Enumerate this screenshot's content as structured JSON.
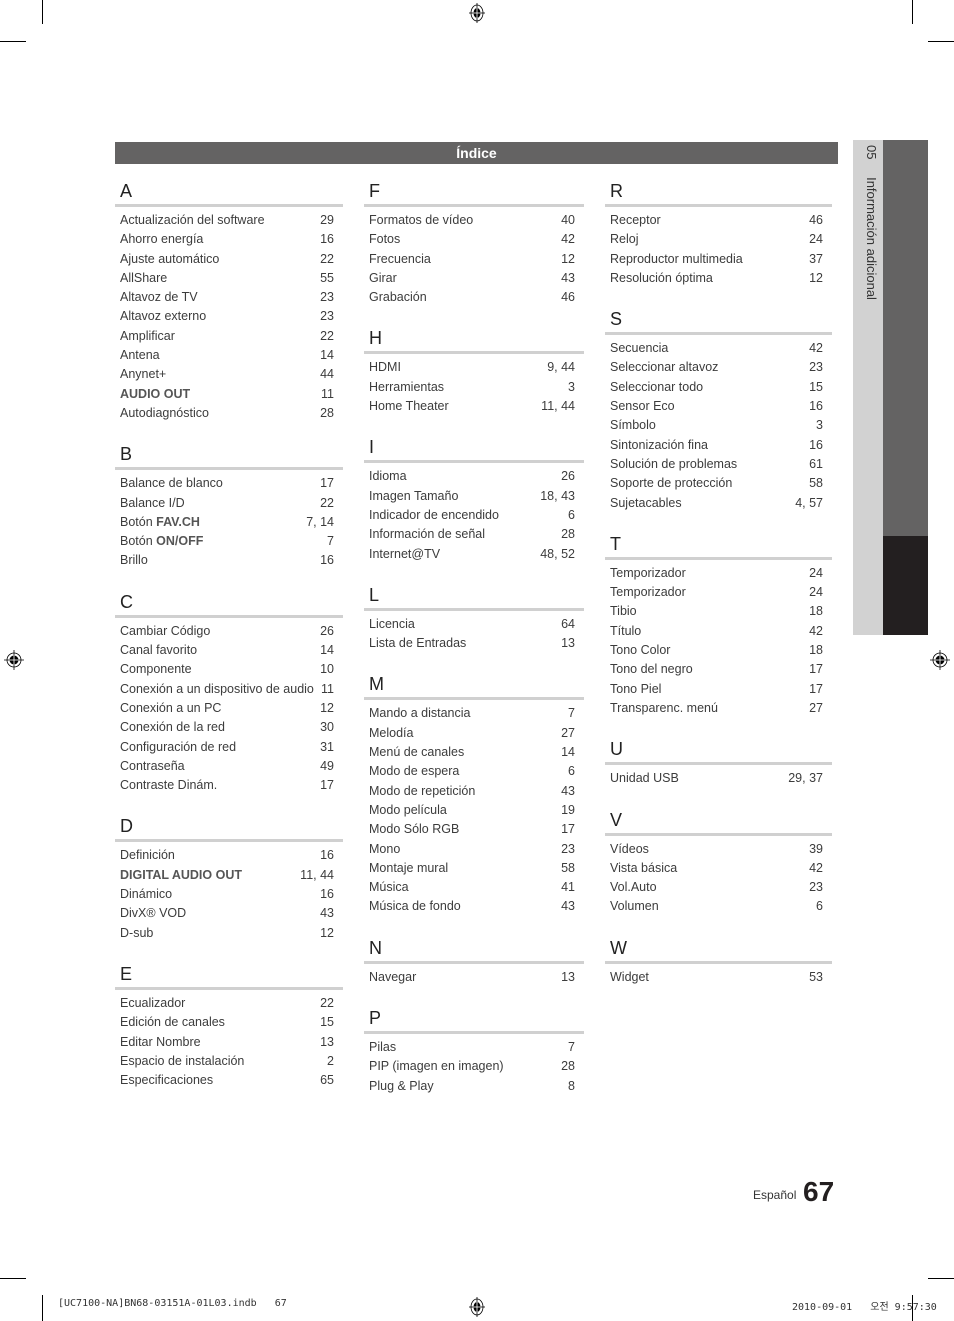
{
  "header": {
    "title": "Índice"
  },
  "side_tab": {
    "chapter_number": "05",
    "chapter_title": "Información adicional"
  },
  "columns": [
    {
      "sections": [
        {
          "letter": "A",
          "entries": [
            {
              "term": "Actualización del software",
              "pages": "29"
            },
            {
              "term": "Ahorro energía",
              "pages": "16"
            },
            {
              "term": "Ajuste automático",
              "pages": "22"
            },
            {
              "term": "AllShare",
              "pages": "55"
            },
            {
              "term": "Altavoz de TV",
              "pages": "23"
            },
            {
              "term": "Altavoz externo",
              "pages": "23"
            },
            {
              "term": "Amplificar",
              "pages": "22"
            },
            {
              "term": "Antena",
              "pages": "14"
            },
            {
              "term": "Anynet+",
              "pages": "44"
            },
            {
              "term": "AUDIO OUT",
              "pages": "11",
              "bold": true
            },
            {
              "term": "Autodiagnóstico",
              "pages": "28"
            }
          ]
        },
        {
          "letter": "B",
          "entries": [
            {
              "term": "Balance de blanco",
              "pages": "17"
            },
            {
              "term": "Balance I/D",
              "pages": "22"
            },
            {
              "term": "Botón ",
              "term_bold": "FAV.CH",
              "pages": "7, 14"
            },
            {
              "term": "Botón ",
              "term_bold": "ON/OFF",
              "pages": "7"
            },
            {
              "term": "Brillo",
              "pages": "16"
            }
          ]
        },
        {
          "letter": "C",
          "entries": [
            {
              "term": "Cambiar Código",
              "pages": "26"
            },
            {
              "term": "Canal favorito",
              "pages": "14"
            },
            {
              "term": "Componente",
              "pages": "10"
            },
            {
              "term": "Conexión a un dispositivo de audio",
              "pages": "11"
            },
            {
              "term": "Conexión a un PC",
              "pages": "12"
            },
            {
              "term": "Conexión de la red",
              "pages": "30"
            },
            {
              "term": "Configuración de red",
              "pages": "31"
            },
            {
              "term": "Contraseña",
              "pages": "49"
            },
            {
              "term": "Contraste Dinám.",
              "pages": "17"
            }
          ]
        },
        {
          "letter": "D",
          "entries": [
            {
              "term": "Definición",
              "pages": "16"
            },
            {
              "term": "DIGITAL AUDIO OUT",
              "pages": "11, 44",
              "bold": true
            },
            {
              "term": "Dinámico",
              "pages": "16"
            },
            {
              "term": "DivX® VOD",
              "pages": "43"
            },
            {
              "term": "D-sub",
              "pages": "12"
            }
          ]
        },
        {
          "letter": "E",
          "entries": [
            {
              "term": "Ecualizador",
              "pages": "22"
            },
            {
              "term": "Edición de canales",
              "pages": "15"
            },
            {
              "term": "Editar Nombre",
              "pages": "13"
            },
            {
              "term": "Espacio de instalación",
              "pages": "2"
            },
            {
              "term": "Especificaciones",
              "pages": "65"
            }
          ]
        }
      ]
    },
    {
      "sections": [
        {
          "letter": "F",
          "entries": [
            {
              "term": "Formatos de vídeo",
              "pages": "40"
            },
            {
              "term": "Fotos",
              "pages": "42"
            },
            {
              "term": "Frecuencia",
              "pages": "12"
            },
            {
              "term": "Girar",
              "pages": "43"
            },
            {
              "term": "Grabación",
              "pages": "46"
            }
          ]
        },
        {
          "letter": "H",
          "entries": [
            {
              "term": "HDMI",
              "pages": "9, 44"
            },
            {
              "term": "Herramientas",
              "pages": "3"
            },
            {
              "term": "Home Theater",
              "pages": "11, 44"
            }
          ]
        },
        {
          "letter": "I",
          "entries": [
            {
              "term": "Idioma",
              "pages": "26"
            },
            {
              "term": "Imagen Tamaño",
              "pages": "18, 43"
            },
            {
              "term": "Indicador de encendido",
              "pages": "6"
            },
            {
              "term": "Información de señal",
              "pages": "28"
            },
            {
              "term": "Internet@TV",
              "pages": "48, 52"
            }
          ]
        },
        {
          "letter": "L",
          "entries": [
            {
              "term": "Licencia",
              "pages": "64"
            },
            {
              "term": "Lista de Entradas",
              "pages": "13"
            }
          ]
        },
        {
          "letter": "M",
          "entries": [
            {
              "term": "Mando a distancia",
              "pages": "7"
            },
            {
              "term": "Melodía",
              "pages": "27"
            },
            {
              "term": "Menú de canales",
              "pages": "14"
            },
            {
              "term": "Modo de espera",
              "pages": "6"
            },
            {
              "term": "Modo de repetición",
              "pages": "43"
            },
            {
              "term": "Modo película",
              "pages": "19"
            },
            {
              "term": "Modo Sólo RGB",
              "pages": "17"
            },
            {
              "term": "Mono",
              "pages": "23"
            },
            {
              "term": "Montaje mural",
              "pages": "58"
            },
            {
              "term": "Música",
              "pages": "41"
            },
            {
              "term": "Música de fondo",
              "pages": "43"
            }
          ]
        },
        {
          "letter": "N",
          "entries": [
            {
              "term": "Navegar",
              "pages": "13"
            }
          ]
        },
        {
          "letter": "P",
          "entries": [
            {
              "term": "Pilas",
              "pages": "7"
            },
            {
              "term": "PIP (imagen en imagen)",
              "pages": "28"
            },
            {
              "term": "Plug & Play",
              "pages": "8"
            }
          ]
        }
      ]
    },
    {
      "sections": [
        {
          "letter": "R",
          "entries": [
            {
              "term": "Receptor",
              "pages": "46"
            },
            {
              "term": "Reloj",
              "pages": "24"
            },
            {
              "term": "Reproductor multimedia",
              "pages": "37"
            },
            {
              "term": "Resolución óptima",
              "pages": "12"
            }
          ]
        },
        {
          "letter": "S",
          "entries": [
            {
              "term": "Secuencia",
              "pages": "42"
            },
            {
              "term": "Seleccionar altavoz",
              "pages": "23"
            },
            {
              "term": "Seleccionar todo",
              "pages": "15"
            },
            {
              "term": "Sensor Eco",
              "pages": "16"
            },
            {
              "term": "Símbolo",
              "pages": "3"
            },
            {
              "term": "Sintonización fina",
              "pages": "16"
            },
            {
              "term": "Solución de problemas",
              "pages": "61"
            },
            {
              "term": "Soporte de protección",
              "pages": "58"
            },
            {
              "term": "Sujetacables",
              "pages": "4, 57"
            }
          ]
        },
        {
          "letter": "T",
          "entries": [
            {
              "term": "Temporizador",
              "pages": "24"
            },
            {
              "term": "Temporizador",
              "pages": "24"
            },
            {
              "term": "Tibio",
              "pages": "18"
            },
            {
              "term": "Título",
              "pages": "42"
            },
            {
              "term": "Tono Color",
              "pages": "18"
            },
            {
              "term": "Tono del negro",
              "pages": "17"
            },
            {
              "term": "Tono Piel",
              "pages": "17"
            },
            {
              "term": "Transparenc. menú",
              "pages": "27"
            }
          ]
        },
        {
          "letter": "U",
          "entries": [
            {
              "term": "Unidad USB",
              "pages": "29, 37"
            }
          ]
        },
        {
          "letter": "V",
          "entries": [
            {
              "term": "Vídeos",
              "pages": "39"
            },
            {
              "term": "Vista básica",
              "pages": "42"
            },
            {
              "term": "Vol.Auto",
              "pages": "23"
            },
            {
              "term": "Volumen",
              "pages": "6"
            }
          ]
        },
        {
          "letter": "W",
          "entries": [
            {
              "term": "Widget",
              "pages": "53"
            }
          ]
        }
      ]
    }
  ],
  "footer": {
    "language": "Español",
    "page_number": "67"
  },
  "print_slug": {
    "file": "[UC7100-NA]BN68-03151A-01L03.indb   67",
    "timestamp": "2010-09-01   오전 9:57:30"
  },
  "colors": {
    "title_bar": "#646363",
    "side_light": "#d2d2d2",
    "side_dark": "#646363",
    "side_black": "#231f20",
    "rule": "#d0d0d0"
  }
}
